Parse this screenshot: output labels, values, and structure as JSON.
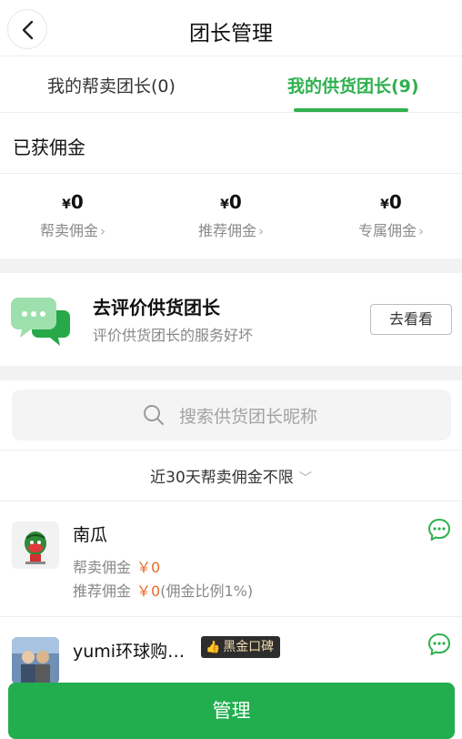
{
  "header": {
    "title": "团长管理"
  },
  "tabs": [
    {
      "label": "我的帮卖团长(0)"
    },
    {
      "label": "我的供货团长(9)"
    }
  ],
  "commission": {
    "title": "已获佣金",
    "stats": [
      {
        "value": "0",
        "currency": "¥",
        "label": "帮卖佣金"
      },
      {
        "value": "0",
        "currency": "¥",
        "label": "推荐佣金"
      },
      {
        "value": "0",
        "currency": "¥",
        "label": "专属佣金"
      }
    ]
  },
  "promo": {
    "title": "去评价供货团长",
    "subtitle": "评价供货团长的服务好坏",
    "button": "去看看"
  },
  "search": {
    "placeholder": "搜索供货团长昵称"
  },
  "filter": {
    "label": "近30天帮卖佣金不限"
  },
  "list": [
    {
      "name": "南瓜",
      "line1_label": "帮卖佣金",
      "line1_amount": "￥0",
      "line2_label": "推荐佣金",
      "line2_amount": "￥0",
      "line2_note": "(佣金比例1%)"
    },
    {
      "name": "yumi环球购…",
      "badge": "黑金口碑"
    }
  ],
  "footer": {
    "manage_button": "管理"
  },
  "colors": {
    "accent": "#2fb04e",
    "amount": "#ec6a2b",
    "button": "#22ae4f"
  }
}
